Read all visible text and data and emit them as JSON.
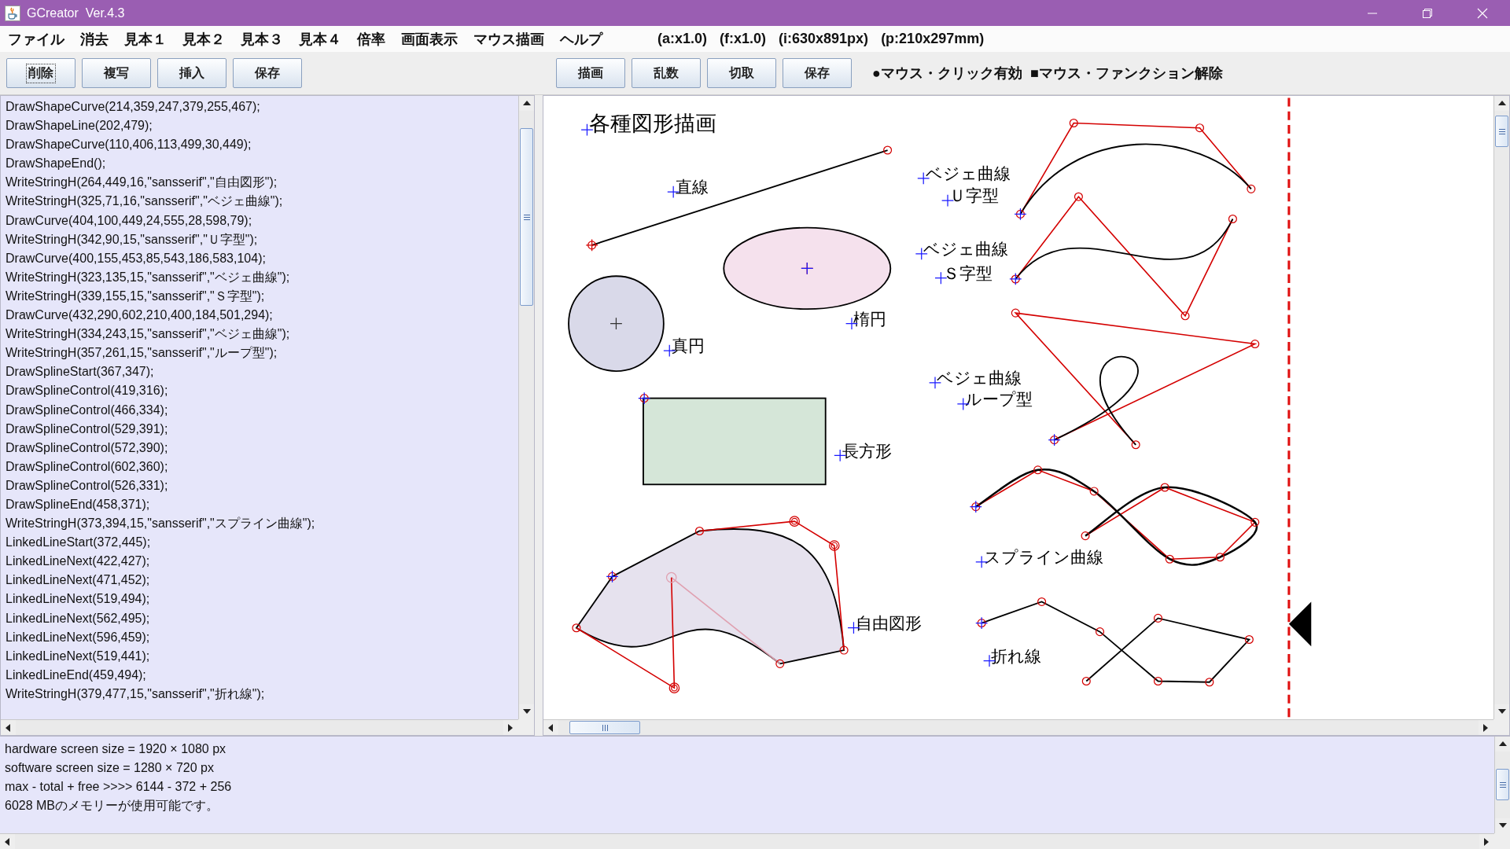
{
  "window": {
    "title": "GCreator  Ver.4.3"
  },
  "menubar": {
    "items": [
      "ファイル",
      "消去",
      "見本１",
      "見本２",
      "見本３",
      "見本４",
      "倍率",
      "画面表示",
      "マウス描画",
      "ヘルプ"
    ],
    "info": [
      "(a:x1.0)",
      "(f:x1.0)",
      "(i:630x891px)",
      "(p:210x297mm)"
    ]
  },
  "toolbar": {
    "left_buttons": [
      {
        "label": "削除",
        "focused": true
      },
      {
        "label": "複写",
        "focused": false
      },
      {
        "label": "挿入",
        "focused": false
      },
      {
        "label": "保存",
        "focused": false
      }
    ],
    "right_buttons": [
      {
        "label": "描画",
        "focused": false
      },
      {
        "label": "乱数",
        "focused": false
      },
      {
        "label": "切取",
        "focused": false
      },
      {
        "label": "保存",
        "focused": false
      }
    ],
    "legend": [
      "●マウス・クリック有効",
      "■マウス・ファンクション解除"
    ]
  },
  "code_editor": {
    "lines": [
      "DrawShapeCurve(214,359,247,379,255,467);",
      "DrawShapeLine(202,479);",
      "DrawShapeCurve(110,406,113,499,30,449);",
      "DrawShapeEnd();",
      "WriteStringH(264,449,16,\"sansserif\",\"自由図形\");",
      "WriteStringH(325,71,16,\"sansserif\",\"ベジェ曲線\");",
      "DrawCurve(404,100,449,24,555,28,598,79);",
      "WriteStringH(342,90,15,\"sansserif\",\"Ｕ字型\");",
      "DrawCurve(400,155,453,85,543,186,583,104);",
      "WriteStringH(323,135,15,\"sansserif\",\"ベジェ曲線\");",
      "WriteStringH(339,155,15,\"sansserif\",\"Ｓ字型\");",
      "DrawCurve(432,290,602,210,400,184,501,294);",
      "WriteStringH(334,243,15,\"sansserif\",\"ベジェ曲線\");",
      "WriteStringH(357,261,15,\"sansserif\",\"ループ型\");",
      "DrawSplineStart(367,347);",
      "DrawSplineControl(419,316);",
      "DrawSplineControl(466,334);",
      "DrawSplineControl(529,391);",
      "DrawSplineControl(572,390);",
      "DrawSplineControl(602,360);",
      "DrawSplineControl(526,331);",
      "DrawSplineEnd(458,371);",
      "WriteStringH(373,394,15,\"sansserif\",\"スプライン曲線\");",
      "LinkedLineStart(372,445);",
      "LinkedLineNext(422,427);",
      "LinkedLineNext(471,452);",
      "LinkedLineNext(519,494);",
      "LinkedLineNext(562,495);",
      "LinkedLineNext(596,459);",
      "LinkedLineNext(519,441);",
      "LinkedLineEnd(459,494);",
      "WriteStringH(379,477,15,\"sansserif\",\"折れ線\");"
    ]
  },
  "canvas": {
    "labels": [
      "各種図形描画",
      "直線",
      "楕円",
      "真円",
      "長方形",
      "自由図形",
      "ベジェ曲線",
      "Ｕ字型",
      "ベジェ曲線",
      "Ｓ字型",
      "ベジェ曲線",
      "ループ型",
      "スプライン曲線",
      "折れ線"
    ]
  },
  "console": {
    "lines": [
      "hardware screen size = 1920 × 1080 px",
      "software screen size = 1280 × 720 px",
      "max - total + free >>>> 6144 - 372 + 256",
      "6028 MBのメモリーが使用可能です。"
    ]
  }
}
